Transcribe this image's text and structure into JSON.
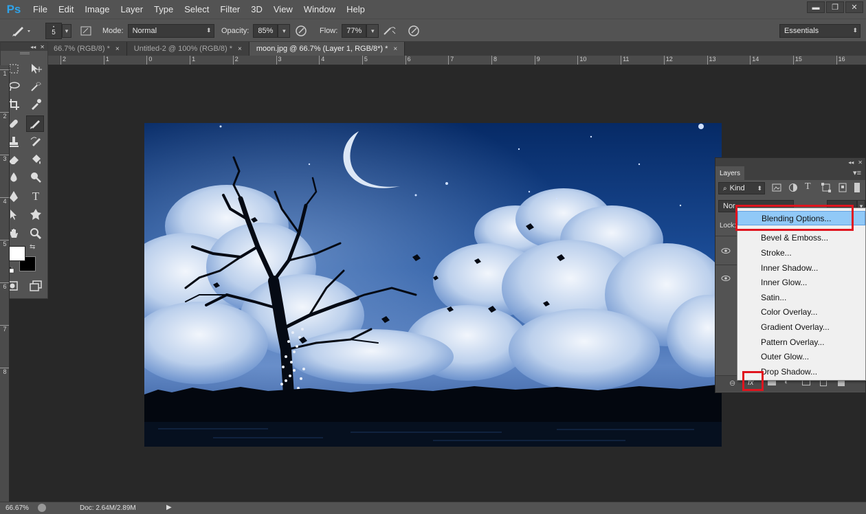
{
  "app": {
    "logo": "Ps"
  },
  "menu": [
    "File",
    "Edit",
    "Image",
    "Layer",
    "Type",
    "Select",
    "Filter",
    "3D",
    "View",
    "Window",
    "Help"
  ],
  "window_controls": {
    "minimize": "▬",
    "restore": "❐",
    "close": "✕"
  },
  "options": {
    "brush_size": "5",
    "mode_label": "Mode:",
    "mode_value": "Normal",
    "opacity_label": "Opacity:",
    "opacity_value": "85%",
    "flow_label": "Flow:",
    "flow_value": "77%",
    "workspace": "Essentials"
  },
  "tabs": [
    {
      "label": "66.7% (RGB/8) *",
      "close": "×"
    },
    {
      "label": "Untitled-2 @ 100% (RGB/8) *",
      "close": "×"
    },
    {
      "label": "moon.jpg @ 66.7% (Layer 1, RGB/8*) *",
      "close": "×"
    }
  ],
  "hruler_ticks": [
    "2",
    "1",
    "0",
    "1",
    "2",
    "3",
    "4",
    "5",
    "6",
    "7",
    "8",
    "9",
    "10",
    "11",
    "12",
    "13",
    "14",
    "15",
    "16"
  ],
  "vruler_ticks": [
    "1",
    "2",
    "3",
    "4",
    "5",
    "6",
    "7",
    "8"
  ],
  "layers_panel": {
    "title": "Layers",
    "filter_kind": "Kind",
    "blend_mode_partial": "Nor",
    "lock_label": "Lock:"
  },
  "fx_menu": {
    "items": [
      "Blending Options...",
      "Bevel & Emboss...",
      "Stroke...",
      "Inner Shadow...",
      "Inner Glow...",
      "Satin...",
      "Color Overlay...",
      "Gradient Overlay...",
      "Pattern Overlay...",
      "Outer Glow...",
      "Drop Shadow..."
    ],
    "highlighted": "Blending Options..."
  },
  "fx_button_label": "fx",
  "status": {
    "zoom": "66.67%",
    "doc": "Doc: 2.64M/2.89M"
  },
  "colors": {
    "accent_highlight": "#91c9f7",
    "annotation_red": "#e0141e",
    "ps_blue": "#2fa3e9"
  }
}
